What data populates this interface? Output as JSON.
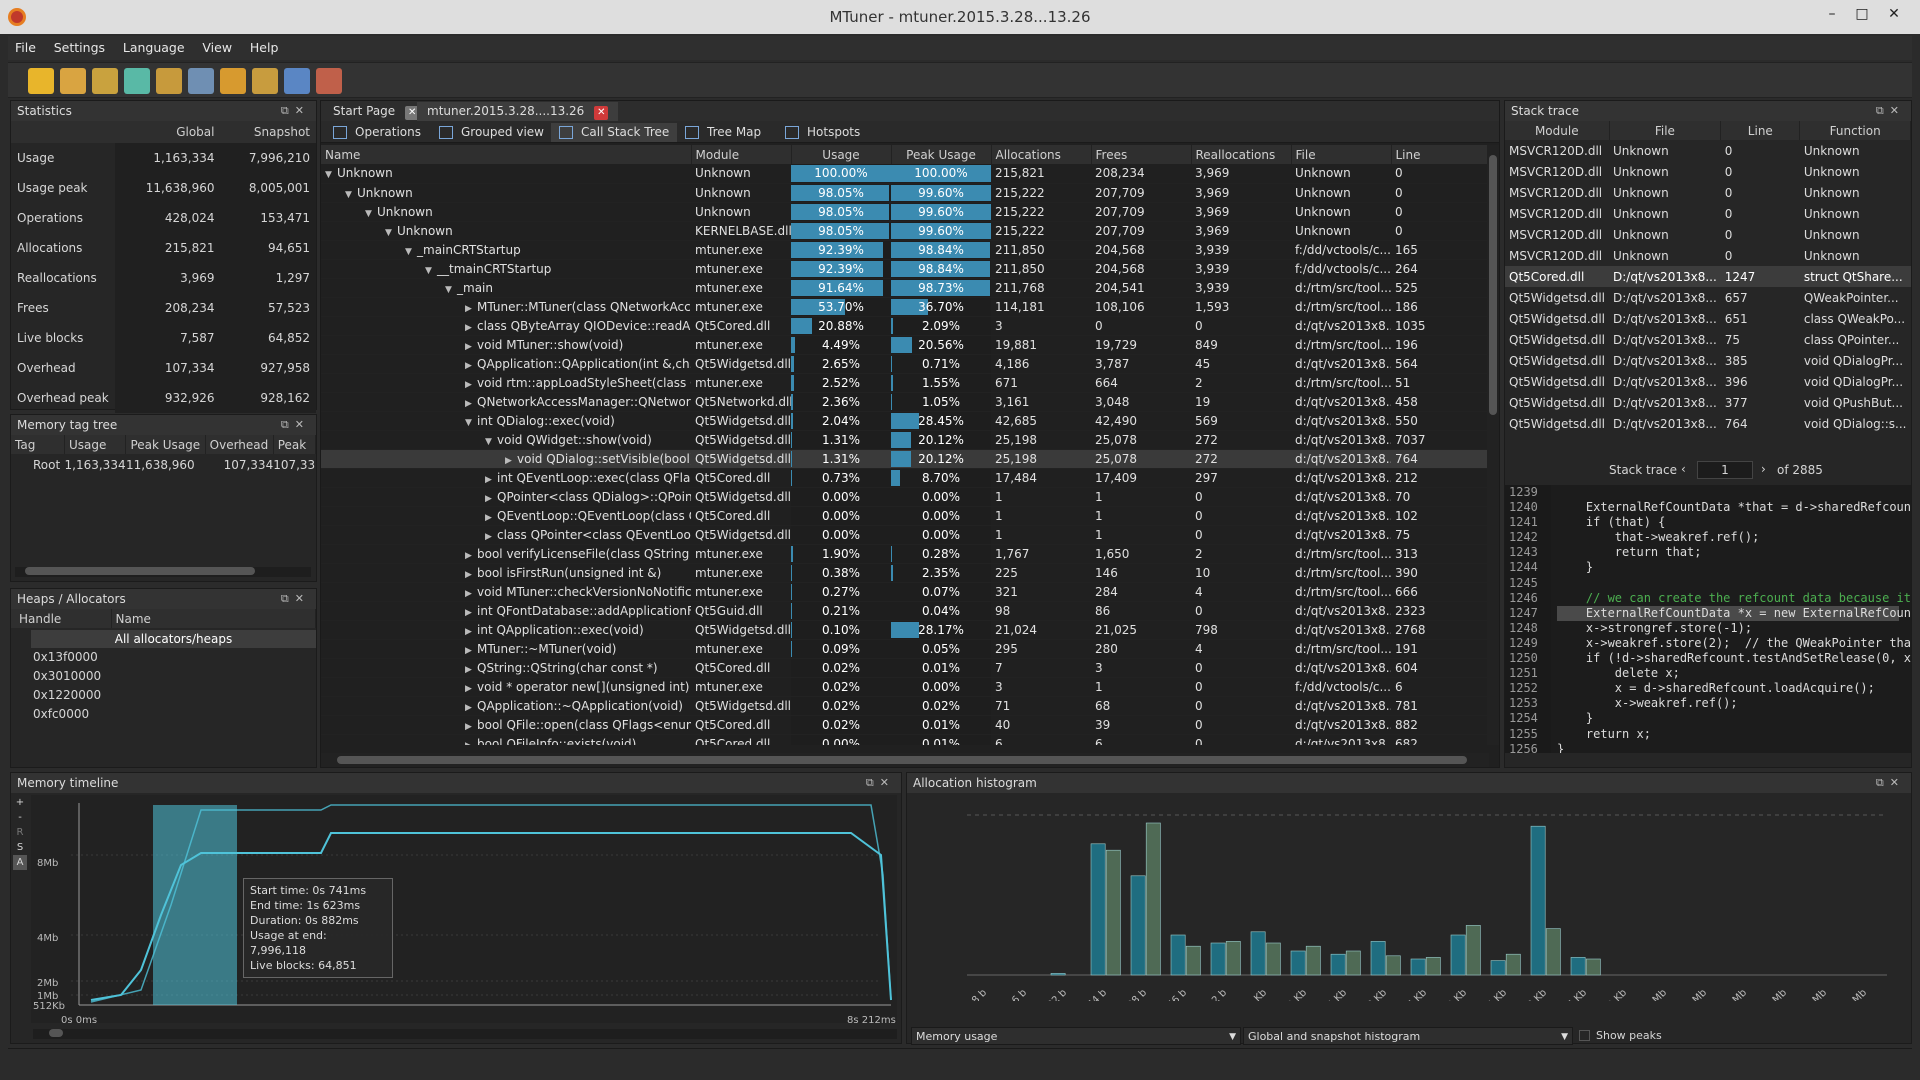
{
  "window": {
    "title": "MTuner - mtuner.2015.3.28...13.26"
  },
  "menu": [
    "File",
    "Settings",
    "Language",
    "View",
    "Help"
  ],
  "toolbar_icons": [
    "folder-icon",
    "clipboard-icon",
    "database-icon",
    "filter-icon",
    "table-icon",
    "tree-icon",
    "chip-icon",
    "line-chart-icon",
    "bar-chart-icon",
    "report-icon"
  ],
  "statistics": {
    "title": "Statistics",
    "col_global": "Global",
    "col_snapshot": "Snapshot",
    "rows": [
      {
        "label": "Usage",
        "global": "1,163,334",
        "snapshot": "7,996,210"
      },
      {
        "label": "Usage peak",
        "global": "11,638,960",
        "snapshot": "8,005,001"
      },
      {
        "label": "Operations",
        "global": "428,024",
        "snapshot": "153,471"
      },
      {
        "label": "Allocations",
        "global": "215,821",
        "snapshot": "94,651"
      },
      {
        "label": "Reallocations",
        "global": "3,969",
        "snapshot": "1,297"
      },
      {
        "label": "Frees",
        "global": "208,234",
        "snapshot": "57,523"
      },
      {
        "label": "Live blocks",
        "global": "7,587",
        "snapshot": "64,852"
      },
      {
        "label": "Overhead",
        "global": "107,334",
        "snapshot": "927,958"
      },
      {
        "label": "Overhead peak",
        "global": "932,926",
        "snapshot": "928,162"
      }
    ]
  },
  "memtag": {
    "title": "Memory tag tree",
    "cols": [
      "Tag",
      "Usage",
      "Peak Usage",
      "Overhead",
      "Peak"
    ],
    "rows": [
      {
        "tag": "Root",
        "usage": "1,163,334",
        "peak_usage": "11,638,960",
        "overhead": "107,334",
        "peak": "107,33"
      }
    ]
  },
  "heaps": {
    "title": "Heaps / Allocators",
    "cols": [
      "Handle",
      "Name"
    ],
    "all": "All allocators/heaps",
    "handles": [
      "0x13f0000",
      "0x3010000",
      "0x1220000",
      "0xfc0000"
    ]
  },
  "tabs": {
    "start": "Start Page",
    "file": "mtuner.2015.3.28....13.26"
  },
  "subtabs": [
    "Operations",
    "Grouped view",
    "Call Stack Tree",
    "Tree Map",
    "Hotspots"
  ],
  "tree": {
    "cols": [
      "Name",
      "Module",
      "Usage",
      "Peak Usage",
      "Allocations",
      "Frees",
      "Reallocations",
      "File",
      "Line"
    ],
    "rows": [
      {
        "indent": 0,
        "exp": "▼",
        "name": "Unknown",
        "module": "Unknown",
        "usage": "100.00%",
        "uf": 100,
        "peak": "100.00%",
        "pf": 100,
        "alloc": "215,821",
        "frees": "208,234",
        "realloc": "3,969",
        "file": "Unknown",
        "line": "0"
      },
      {
        "indent": 1,
        "exp": "▼",
        "name": "Unknown",
        "module": "Unknown",
        "usage": "98.05%",
        "uf": 98.05,
        "peak": "99.60%",
        "pf": 99.6,
        "alloc": "215,222",
        "frees": "207,709",
        "realloc": "3,969",
        "file": "Unknown",
        "line": "0"
      },
      {
        "indent": 2,
        "exp": "▼",
        "name": "Unknown",
        "module": "Unknown",
        "usage": "98.05%",
        "uf": 98.05,
        "peak": "99.60%",
        "pf": 99.6,
        "alloc": "215,222",
        "frees": "207,709",
        "realloc": "3,969",
        "file": "Unknown",
        "line": "0"
      },
      {
        "indent": 3,
        "exp": "▼",
        "name": "Unknown",
        "module": "KERNELBASE.dll",
        "usage": "98.05%",
        "uf": 98.05,
        "peak": "99.60%",
        "pf": 99.6,
        "alloc": "215,222",
        "frees": "207,709",
        "realloc": "3,969",
        "file": "Unknown",
        "line": "0"
      },
      {
        "indent": 4,
        "exp": "▼",
        "name": "_mainCRTStartup",
        "module": "mtuner.exe",
        "usage": "92.39%",
        "uf": 92.39,
        "peak": "98.84%",
        "pf": 98.84,
        "alloc": "211,850",
        "frees": "204,568",
        "realloc": "3,939",
        "file": "f:/dd/vctools/c...",
        "line": "165"
      },
      {
        "indent": 5,
        "exp": "▼",
        "name": "__tmainCRTStartup",
        "module": "mtuner.exe",
        "usage": "92.39%",
        "uf": 92.39,
        "peak": "98.84%",
        "pf": 98.84,
        "alloc": "211,850",
        "frees": "204,568",
        "realloc": "3,939",
        "file": "f:/dd/vctools/c...",
        "line": "264"
      },
      {
        "indent": 6,
        "exp": "▼",
        "name": "_main",
        "module": "mtuner.exe",
        "usage": "91.64%",
        "uf": 91.64,
        "peak": "98.73%",
        "pf": 98.73,
        "alloc": "211,768",
        "frees": "204,541",
        "realloc": "3,939",
        "file": "d:/rtm/src/tool...",
        "line": "525"
      },
      {
        "indent": 7,
        "exp": "▶",
        "name": "MTuner::MTuner(class QNetworkAcc...",
        "module": "mtuner.exe",
        "usage": "53.70%",
        "uf": 53.7,
        "peak": "36.70%",
        "pf": 36.7,
        "alloc": "114,181",
        "frees": "108,106",
        "realloc": "1,593",
        "file": "d:/rtm/src/tool...",
        "line": "186"
      },
      {
        "indent": 7,
        "exp": "▶",
        "name": "class QByteArray QIODevice::readAll(...",
        "module": "Qt5Cored.dll",
        "usage": "20.88%",
        "uf": 20.88,
        "peak": "2.09%",
        "pf": 2.09,
        "alloc": "3",
        "frees": "0",
        "realloc": "0",
        "file": "d:/qt/vs2013x8...",
        "line": "1035"
      },
      {
        "indent": 7,
        "exp": "▶",
        "name": "void MTuner::show(void)",
        "module": "mtuner.exe",
        "usage": "4.49%",
        "uf": 4.49,
        "peak": "20.56%",
        "pf": 20.56,
        "alloc": "19,881",
        "frees": "19,729",
        "realloc": "849",
        "file": "d:/rtm/src/tool...",
        "line": "196"
      },
      {
        "indent": 7,
        "exp": "▶",
        "name": "QApplication::QApplication(int &,ch...",
        "module": "Qt5Widgetsd.dll",
        "usage": "2.65%",
        "uf": 2.65,
        "peak": "0.71%",
        "pf": 0.71,
        "alloc": "4,186",
        "frees": "3,787",
        "realloc": "45",
        "file": "d:/qt/vs2013x8...",
        "line": "564"
      },
      {
        "indent": 7,
        "exp": "▶",
        "name": "void rtm::appLoadStyleSheet(class Q...",
        "module": "mtuner.exe",
        "usage": "2.52%",
        "uf": 2.52,
        "peak": "1.55%",
        "pf": 1.55,
        "alloc": "671",
        "frees": "664",
        "realloc": "2",
        "file": "d:/rtm/src/tool...",
        "line": "51"
      },
      {
        "indent": 7,
        "exp": "▶",
        "name": "QNetworkAccessManager::QNetwork...",
        "module": "Qt5Networkd.dll",
        "usage": "2.36%",
        "uf": 2.36,
        "peak": "1.05%",
        "pf": 1.05,
        "alloc": "3,161",
        "frees": "3,048",
        "realloc": "19",
        "file": "d:/qt/vs2013x8...",
        "line": "458"
      },
      {
        "indent": 7,
        "exp": "▼",
        "name": "int QDialog::exec(void)",
        "module": "Qt5Widgetsd.dll",
        "usage": "2.04%",
        "uf": 2.04,
        "peak": "28.45%",
        "pf": 28.45,
        "alloc": "42,685",
        "frees": "42,490",
        "realloc": "569",
        "file": "d:/qt/vs2013x8...",
        "line": "550"
      },
      {
        "indent": 8,
        "exp": "▼",
        "name": "void QWidget::show(void)",
        "module": "Qt5Widgetsd.dll",
        "usage": "1.31%",
        "uf": 1.31,
        "peak": "20.12%",
        "pf": 20.12,
        "alloc": "25,198",
        "frees": "25,078",
        "realloc": "272",
        "file": "d:/qt/vs2013x8...",
        "line": "7037"
      },
      {
        "indent": 9,
        "exp": "▶",
        "name": "void QDialog::setVisible(bool)",
        "module": "Qt5Widgetsd.dll",
        "usage": "1.31%",
        "uf": 1.31,
        "peak": "20.12%",
        "pf": 20.12,
        "alloc": "25,198",
        "frees": "25,078",
        "realloc": "272",
        "file": "d:/qt/vs2013x8...",
        "line": "764",
        "sel": true
      },
      {
        "indent": 8,
        "exp": "▶",
        "name": "int QEventLoop::exec(class QFlag...",
        "module": "Qt5Cored.dll",
        "usage": "0.73%",
        "uf": 0.73,
        "peak": "8.70%",
        "pf": 8.7,
        "alloc": "17,484",
        "frees": "17,409",
        "realloc": "297",
        "file": "d:/qt/vs2013x8...",
        "line": "212"
      },
      {
        "indent": 8,
        "exp": "▶",
        "name": "QPointer<class QDialog>::QPoint...",
        "module": "Qt5Widgetsd.dll",
        "usage": "0.00%",
        "uf": 0,
        "peak": "0.00%",
        "pf": 0,
        "alloc": "1",
        "frees": "1",
        "realloc": "0",
        "file": "d:/qt/vs2013x8...",
        "line": "70"
      },
      {
        "indent": 8,
        "exp": "▶",
        "name": "QEventLoop::QEventLoop(class Q...",
        "module": "Qt5Cored.dll",
        "usage": "0.00%",
        "uf": 0,
        "peak": "0.00%",
        "pf": 0,
        "alloc": "1",
        "frees": "1",
        "realloc": "0",
        "file": "d:/qt/vs2013x8...",
        "line": "102"
      },
      {
        "indent": 8,
        "exp": "▶",
        "name": "class QPointer<class QEventLoop...",
        "module": "Qt5Widgetsd.dll",
        "usage": "0.00%",
        "uf": 0,
        "peak": "0.00%",
        "pf": 0,
        "alloc": "1",
        "frees": "1",
        "realloc": "0",
        "file": "d:/qt/vs2013x8...",
        "line": "75"
      },
      {
        "indent": 7,
        "exp": "▶",
        "name": "bool verifyLicenseFile(class QString &)",
        "module": "mtuner.exe",
        "usage": "1.90%",
        "uf": 1.9,
        "peak": "0.28%",
        "pf": 0.28,
        "alloc": "1,767",
        "frees": "1,650",
        "realloc": "2",
        "file": "d:/rtm/src/tool...",
        "line": "313"
      },
      {
        "indent": 7,
        "exp": "▶",
        "name": "bool isFirstRun(unsigned int &)",
        "module": "mtuner.exe",
        "usage": "0.38%",
        "uf": 0.38,
        "peak": "2.35%",
        "pf": 2.35,
        "alloc": "225",
        "frees": "146",
        "realloc": "10",
        "file": "d:/rtm/src/tool...",
        "line": "390"
      },
      {
        "indent": 7,
        "exp": "▶",
        "name": "void MTuner::checkVersionNoNotific...",
        "module": "mtuner.exe",
        "usage": "0.27%",
        "uf": 0.27,
        "peak": "0.07%",
        "pf": 0.07,
        "alloc": "321",
        "frees": "284",
        "realloc": "4",
        "file": "d:/rtm/src/tool...",
        "line": "666"
      },
      {
        "indent": 7,
        "exp": "▶",
        "name": "int QFontDatabase::addApplicationFo...",
        "module": "Qt5Guid.dll",
        "usage": "0.21%",
        "uf": 0.21,
        "peak": "0.04%",
        "pf": 0.04,
        "alloc": "98",
        "frees": "86",
        "realloc": "0",
        "file": "d:/qt/vs2013x8...",
        "line": "2323"
      },
      {
        "indent": 7,
        "exp": "▶",
        "name": "int QApplication::exec(void)",
        "module": "Qt5Widgetsd.dll",
        "usage": "0.10%",
        "uf": 0.1,
        "peak": "28.17%",
        "pf": 28.17,
        "alloc": "21,024",
        "frees": "21,025",
        "realloc": "798",
        "file": "d:/qt/vs2013x8...",
        "line": "2768"
      },
      {
        "indent": 7,
        "exp": "▶",
        "name": "MTuner::~MTuner(void)",
        "module": "mtuner.exe",
        "usage": "0.09%",
        "uf": 0.09,
        "peak": "0.05%",
        "pf": 0.05,
        "alloc": "295",
        "frees": "280",
        "realloc": "4",
        "file": "d:/rtm/src/tool...",
        "line": "191"
      },
      {
        "indent": 7,
        "exp": "▶",
        "name": "QString::QString(char const *)",
        "module": "Qt5Cored.dll",
        "usage": "0.02%",
        "uf": 0.02,
        "peak": "0.01%",
        "pf": 0.01,
        "alloc": "7",
        "frees": "3",
        "realloc": "0",
        "file": "d:/qt/vs2013x8...",
        "line": "604"
      },
      {
        "indent": 7,
        "exp": "▶",
        "name": "void * operator new[](unsigned int)",
        "module": "mtuner.exe",
        "usage": "0.02%",
        "uf": 0.02,
        "peak": "0.00%",
        "pf": 0,
        "alloc": "3",
        "frees": "1",
        "realloc": "0",
        "file": "f:/dd/vctools/c...",
        "line": "6"
      },
      {
        "indent": 7,
        "exp": "▶",
        "name": "QApplication::~QApplication(void)",
        "module": "Qt5Widgetsd.dll",
        "usage": "0.02%",
        "uf": 0.02,
        "peak": "0.02%",
        "pf": 0.02,
        "alloc": "71",
        "frees": "68",
        "realloc": "0",
        "file": "d:/qt/vs2013x8...",
        "line": "781"
      },
      {
        "indent": 7,
        "exp": "▶",
        "name": "bool QFile::open(class QFlags<enum ...",
        "module": "Qt5Cored.dll",
        "usage": "0.02%",
        "uf": 0.02,
        "peak": "0.01%",
        "pf": 0.01,
        "alloc": "40",
        "frees": "39",
        "realloc": "0",
        "file": "d:/qt/vs2013x8...",
        "line": "882"
      },
      {
        "indent": 7,
        "exp": "▶",
        "name": "bool QFileInfo::exists(void)",
        "module": "Qt5Cored.dll",
        "usage": "0.00%",
        "uf": 0,
        "peak": "0.01%",
        "pf": 0.01,
        "alloc": "6",
        "frees": "6",
        "realloc": "0",
        "file": "d:/qt/vs2013x8...",
        "line": "682"
      }
    ]
  },
  "stacktrace": {
    "title": "Stack trace",
    "cols": [
      "Module",
      "File",
      "Line",
      "Function"
    ],
    "rows": [
      {
        "m": "MSVCR120D.dll",
        "f": "Unknown",
        "l": "0",
        "fn": "Unknown"
      },
      {
        "m": "MSVCR120D.dll",
        "f": "Unknown",
        "l": "0",
        "fn": "Unknown"
      },
      {
        "m": "MSVCR120D.dll",
        "f": "Unknown",
        "l": "0",
        "fn": "Unknown"
      },
      {
        "m": "MSVCR120D.dll",
        "f": "Unknown",
        "l": "0",
        "fn": "Unknown"
      },
      {
        "m": "MSVCR120D.dll",
        "f": "Unknown",
        "l": "0",
        "fn": "Unknown"
      },
      {
        "m": "MSVCR120D.dll",
        "f": "Unknown",
        "l": "0",
        "fn": "Unknown"
      },
      {
        "m": "Qt5Cored.dll",
        "f": "D:/qt/vs2013x8...",
        "l": "1247",
        "fn": "struct QtShare...",
        "sel": true
      },
      {
        "m": "Qt5Widgetsd.dll",
        "f": "D:/qt/vs2013x8...",
        "l": "657",
        "fn": "QWeakPointer..."
      },
      {
        "m": "Qt5Widgetsd.dll",
        "f": "D:/qt/vs2013x8...",
        "l": "651",
        "fn": "class QWeakPo..."
      },
      {
        "m": "Qt5Widgetsd.dll",
        "f": "D:/qt/vs2013x8...",
        "l": "75",
        "fn": "class QPointer..."
      },
      {
        "m": "Qt5Widgetsd.dll",
        "f": "D:/qt/vs2013x8...",
        "l": "385",
        "fn": "void QDialogPr..."
      },
      {
        "m": "Qt5Widgetsd.dll",
        "f": "D:/qt/vs2013x8...",
        "l": "396",
        "fn": "void QDialogPr..."
      },
      {
        "m": "Qt5Widgetsd.dll",
        "f": "D:/qt/vs2013x8...",
        "l": "377",
        "fn": "void QPushBut..."
      },
      {
        "m": "Qt5Widgetsd.dll",
        "f": "D:/qt/vs2013x8...",
        "l": "764",
        "fn": "void QDialog::s..."
      }
    ],
    "nav_label": "Stack trace",
    "nav_value": "1",
    "nav_total": "of 2885"
  },
  "code": {
    "lines": [
      "1239",
      "1240",
      "1241",
      "1242",
      "1243",
      "1244",
      "1245",
      "1246",
      "1247",
      "1248",
      "1249",
      "1250",
      "1251",
      "1252",
      "1253",
      "1254",
      "1255",
      "1256"
    ],
    "src": [
      "",
      "    ExternalRefCountData *that = d->sharedRefcount.",
      "    if (that) {",
      "        that->weakref.ref();",
      "        return that;",
      "    }",
      "",
      "    // we can create the refcount data because it d",
      "    ExternalRefCountData *x = new ExternalRefCountD",
      "    x->strongref.store(-1);",
      "    x->weakref.store(2);  // the QWeakPointer that",
      "    if (!d->sharedRefcount.testAndSetRelease(0, x))",
      "        delete x;",
      "        x = d->sharedRefcount.loadAcquire();",
      "        x->weakref.ref();",
      "    }",
      "    return x;",
      "}"
    ],
    "highlight": 8
  },
  "timeline": {
    "title": "Memory timeline",
    "side_buttons": [
      "+",
      "-",
      "R",
      "S",
      "A"
    ],
    "y_labels": [
      "8Mb",
      "4Mb",
      "2Mb",
      "1Mb",
      "512Kb"
    ],
    "x_start": "0s 0ms",
    "x_end": "8s 212ms",
    "tooltip": [
      "Start time: 0s 741ms",
      "End time: 1s 623ms",
      "Duration: 0s 882ms",
      "Usage at end: 7,996,118",
      "Live blocks: 64,851"
    ]
  },
  "histogram": {
    "title": "Allocation histogram",
    "combo_left": "Memory usage",
    "combo_right": "Global and snapshot histogram",
    "checkbox": "Show peaks"
  },
  "chart_data": {
    "type": "bar",
    "title": "Allocation histogram",
    "categories": [
      "8 b",
      "16 b",
      "32 b",
      "64 b",
      "128 b",
      "256 b",
      "512 b",
      "1 Kb",
      "2 Kb",
      "4 Kb",
      "8 Kb",
      "16 Kb",
      "32 Kb",
      "64 Kb",
      "128 Kb",
      "256 Kb",
      "512 Kb",
      "1 Mb",
      "2 Mb",
      "4 Mb",
      "8 Mb",
      "16 Mb",
      "32 Mb"
    ],
    "series": [
      {
        "values": [
          0,
          0,
          1,
          82,
          62,
          25,
          20,
          27,
          15,
          13,
          21,
          10,
          25,
          9,
          93,
          11,
          0,
          0,
          0,
          0,
          0,
          0,
          0
        ]
      },
      {
        "values": [
          0,
          0,
          0,
          78,
          95,
          18,
          21,
          20,
          18,
          15,
          12,
          11,
          31,
          13,
          29,
          10,
          0,
          0,
          0,
          0,
          0,
          0,
          0
        ]
      }
    ],
    "ylim": [
      0,
      100
    ]
  },
  "colors": {
    "accent": "#3b8bb1",
    "bar_dark": "#1f6d80",
    "bar_green": "#4f6a55"
  }
}
